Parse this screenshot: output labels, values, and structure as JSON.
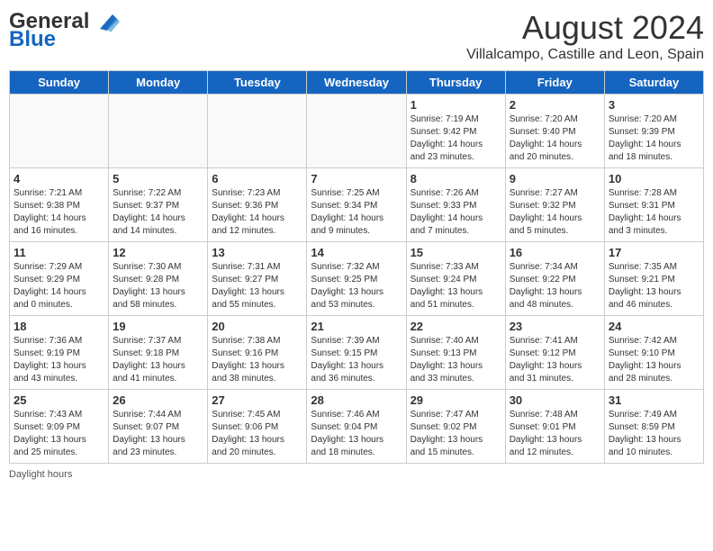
{
  "header": {
    "logo_line1": "General",
    "logo_line2": "Blue",
    "main_title": "August 2024",
    "subtitle": "Villalcampo, Castille and Leon, Spain"
  },
  "columns": [
    "Sunday",
    "Monday",
    "Tuesday",
    "Wednesday",
    "Thursday",
    "Friday",
    "Saturday"
  ],
  "weeks": [
    [
      {
        "day": "",
        "info": ""
      },
      {
        "day": "",
        "info": ""
      },
      {
        "day": "",
        "info": ""
      },
      {
        "day": "",
        "info": ""
      },
      {
        "day": "1",
        "info": "Sunrise: 7:19 AM\nSunset: 9:42 PM\nDaylight: 14 hours\nand 23 minutes."
      },
      {
        "day": "2",
        "info": "Sunrise: 7:20 AM\nSunset: 9:40 PM\nDaylight: 14 hours\nand 20 minutes."
      },
      {
        "day": "3",
        "info": "Sunrise: 7:20 AM\nSunset: 9:39 PM\nDaylight: 14 hours\nand 18 minutes."
      }
    ],
    [
      {
        "day": "4",
        "info": "Sunrise: 7:21 AM\nSunset: 9:38 PM\nDaylight: 14 hours\nand 16 minutes."
      },
      {
        "day": "5",
        "info": "Sunrise: 7:22 AM\nSunset: 9:37 PM\nDaylight: 14 hours\nand 14 minutes."
      },
      {
        "day": "6",
        "info": "Sunrise: 7:23 AM\nSunset: 9:36 PM\nDaylight: 14 hours\nand 12 minutes."
      },
      {
        "day": "7",
        "info": "Sunrise: 7:25 AM\nSunset: 9:34 PM\nDaylight: 14 hours\nand 9 minutes."
      },
      {
        "day": "8",
        "info": "Sunrise: 7:26 AM\nSunset: 9:33 PM\nDaylight: 14 hours\nand 7 minutes."
      },
      {
        "day": "9",
        "info": "Sunrise: 7:27 AM\nSunset: 9:32 PM\nDaylight: 14 hours\nand 5 minutes."
      },
      {
        "day": "10",
        "info": "Sunrise: 7:28 AM\nSunset: 9:31 PM\nDaylight: 14 hours\nand 3 minutes."
      }
    ],
    [
      {
        "day": "11",
        "info": "Sunrise: 7:29 AM\nSunset: 9:29 PM\nDaylight: 14 hours\nand 0 minutes."
      },
      {
        "day": "12",
        "info": "Sunrise: 7:30 AM\nSunset: 9:28 PM\nDaylight: 13 hours\nand 58 minutes."
      },
      {
        "day": "13",
        "info": "Sunrise: 7:31 AM\nSunset: 9:27 PM\nDaylight: 13 hours\nand 55 minutes."
      },
      {
        "day": "14",
        "info": "Sunrise: 7:32 AM\nSunset: 9:25 PM\nDaylight: 13 hours\nand 53 minutes."
      },
      {
        "day": "15",
        "info": "Sunrise: 7:33 AM\nSunset: 9:24 PM\nDaylight: 13 hours\nand 51 minutes."
      },
      {
        "day": "16",
        "info": "Sunrise: 7:34 AM\nSunset: 9:22 PM\nDaylight: 13 hours\nand 48 minutes."
      },
      {
        "day": "17",
        "info": "Sunrise: 7:35 AM\nSunset: 9:21 PM\nDaylight: 13 hours\nand 46 minutes."
      }
    ],
    [
      {
        "day": "18",
        "info": "Sunrise: 7:36 AM\nSunset: 9:19 PM\nDaylight: 13 hours\nand 43 minutes."
      },
      {
        "day": "19",
        "info": "Sunrise: 7:37 AM\nSunset: 9:18 PM\nDaylight: 13 hours\nand 41 minutes."
      },
      {
        "day": "20",
        "info": "Sunrise: 7:38 AM\nSunset: 9:16 PM\nDaylight: 13 hours\nand 38 minutes."
      },
      {
        "day": "21",
        "info": "Sunrise: 7:39 AM\nSunset: 9:15 PM\nDaylight: 13 hours\nand 36 minutes."
      },
      {
        "day": "22",
        "info": "Sunrise: 7:40 AM\nSunset: 9:13 PM\nDaylight: 13 hours\nand 33 minutes."
      },
      {
        "day": "23",
        "info": "Sunrise: 7:41 AM\nSunset: 9:12 PM\nDaylight: 13 hours\nand 31 minutes."
      },
      {
        "day": "24",
        "info": "Sunrise: 7:42 AM\nSunset: 9:10 PM\nDaylight: 13 hours\nand 28 minutes."
      }
    ],
    [
      {
        "day": "25",
        "info": "Sunrise: 7:43 AM\nSunset: 9:09 PM\nDaylight: 13 hours\nand 25 minutes."
      },
      {
        "day": "26",
        "info": "Sunrise: 7:44 AM\nSunset: 9:07 PM\nDaylight: 13 hours\nand 23 minutes."
      },
      {
        "day": "27",
        "info": "Sunrise: 7:45 AM\nSunset: 9:06 PM\nDaylight: 13 hours\nand 20 minutes."
      },
      {
        "day": "28",
        "info": "Sunrise: 7:46 AM\nSunset: 9:04 PM\nDaylight: 13 hours\nand 18 minutes."
      },
      {
        "day": "29",
        "info": "Sunrise: 7:47 AM\nSunset: 9:02 PM\nDaylight: 13 hours\nand 15 minutes."
      },
      {
        "day": "30",
        "info": "Sunrise: 7:48 AM\nSunset: 9:01 PM\nDaylight: 13 hours\nand 12 minutes."
      },
      {
        "day": "31",
        "info": "Sunrise: 7:49 AM\nSunset: 8:59 PM\nDaylight: 13 hours\nand 10 minutes."
      }
    ]
  ],
  "footer": {
    "note": "Daylight hours"
  }
}
